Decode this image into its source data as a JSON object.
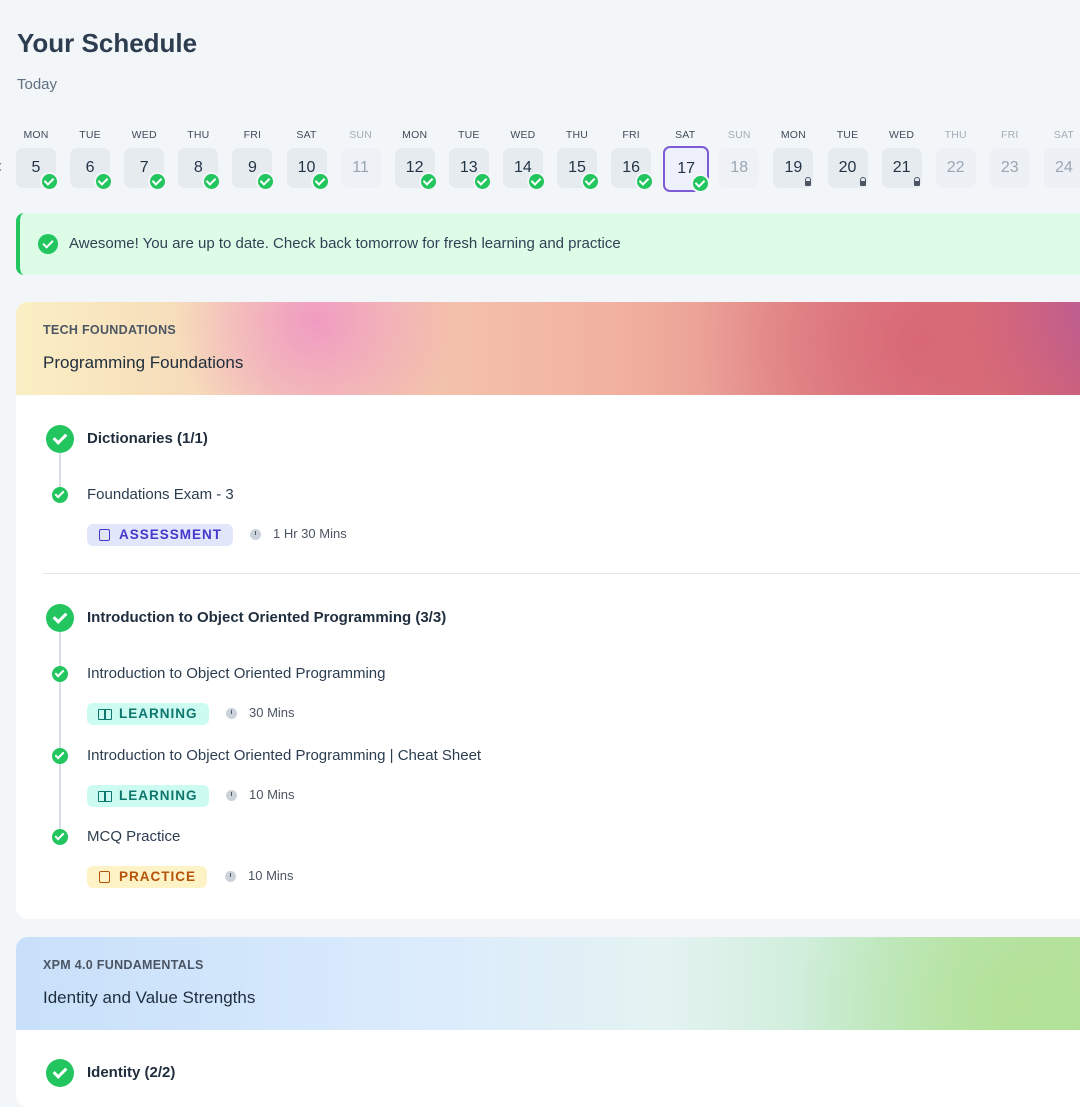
{
  "header": {
    "title": "Your Schedule",
    "subtitle": "Today"
  },
  "calendar": {
    "prev_icon": "chevron-left-icon",
    "days": [
      {
        "dow": "MON",
        "date": "5",
        "status": "done"
      },
      {
        "dow": "TUE",
        "date": "6",
        "status": "done"
      },
      {
        "dow": "WED",
        "date": "7",
        "status": "done"
      },
      {
        "dow": "THU",
        "date": "8",
        "status": "done"
      },
      {
        "dow": "FRI",
        "date": "9",
        "status": "done"
      },
      {
        "dow": "SAT",
        "date": "10",
        "status": "done"
      },
      {
        "dow": "SUN",
        "date": "11",
        "status": "off"
      },
      {
        "dow": "MON",
        "date": "12",
        "status": "done"
      },
      {
        "dow": "TUE",
        "date": "13",
        "status": "done"
      },
      {
        "dow": "WED",
        "date": "14",
        "status": "done"
      },
      {
        "dow": "THU",
        "date": "15",
        "status": "done"
      },
      {
        "dow": "FRI",
        "date": "16",
        "status": "done"
      },
      {
        "dow": "SAT",
        "date": "17",
        "status": "selected"
      },
      {
        "dow": "SUN",
        "date": "18",
        "status": "off"
      },
      {
        "dow": "MON",
        "date": "19",
        "status": "locked"
      },
      {
        "dow": "TUE",
        "date": "20",
        "status": "locked"
      },
      {
        "dow": "WED",
        "date": "21",
        "status": "locked"
      },
      {
        "dow": "THU",
        "date": "22",
        "status": "future"
      },
      {
        "dow": "FRI",
        "date": "23",
        "status": "future"
      },
      {
        "dow": "SAT",
        "date": "24",
        "status": "future"
      }
    ]
  },
  "banner": {
    "text": "Awesome! You are up to date. Check back tomorrow for fresh learning and practice",
    "icon": "check-circle-icon",
    "color": "#22c55e"
  },
  "course1": {
    "category": "TECH FOUNDATIONS",
    "title": "Programming Foundations",
    "modules": [
      {
        "title": "Dictionaries (1/1)",
        "items": [
          {
            "title": "Foundations Exam - 3",
            "tag": "ASSESSMENT",
            "duration": "1 Hr 30 Mins"
          }
        ]
      },
      {
        "title": "Introduction to Object Oriented Programming (3/3)",
        "items": [
          {
            "title": "Introduction to Object Oriented Programming",
            "tag": "LEARNING",
            "duration": "30 Mins"
          },
          {
            "title": "Introduction to Object Oriented Programming | Cheat Sheet",
            "tag": "LEARNING",
            "duration": "10 Mins"
          },
          {
            "title": "MCQ Practice",
            "tag": "PRACTICE",
            "duration": "10 Mins"
          }
        ]
      }
    ]
  },
  "course2": {
    "category": "XPM 4.0 FUNDAMENTALS",
    "title": "Identity and Value Strengths",
    "modules": [
      {
        "title": "Identity (2/2)"
      }
    ]
  },
  "colors": {
    "accent": "#7c5cd6",
    "success": "#22c55e"
  }
}
